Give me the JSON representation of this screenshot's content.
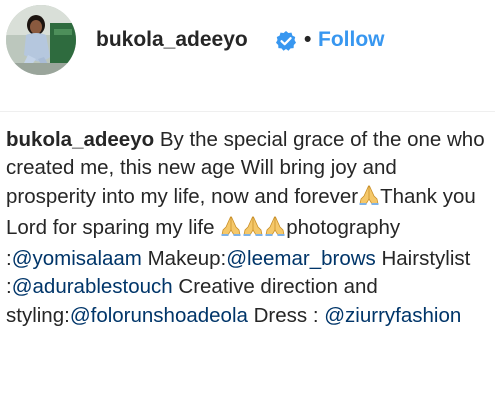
{
  "header": {
    "username": "bukola_adeeyo",
    "verified_icon": "verified-badge-icon",
    "separator": "•",
    "follow_label": "Follow",
    "follow_color": "#3897f0"
  },
  "caption": {
    "username": "bukola_adeeyo",
    "text_1": " By the special grace of the one who created me, this new age Will bring joy and prosperity into my life, now and forever",
    "text_2": "Thank you Lord for sparing my life ",
    "text_3": "photography :",
    "mention_1": "@yomisalaam",
    "text_4": " Makeup:",
    "mention_2": "@leemar_brows",
    "text_5": " Hairstylist :",
    "mention_3": "@adurablestouch",
    "text_6": " Creative direction and styling:",
    "mention_4": "@folorunshoadeola",
    "text_7": " Dress : ",
    "mention_5": "@ziurryfashion",
    "emoji_icon": "folded-hands-icon",
    "mention_color": "#003569"
  }
}
